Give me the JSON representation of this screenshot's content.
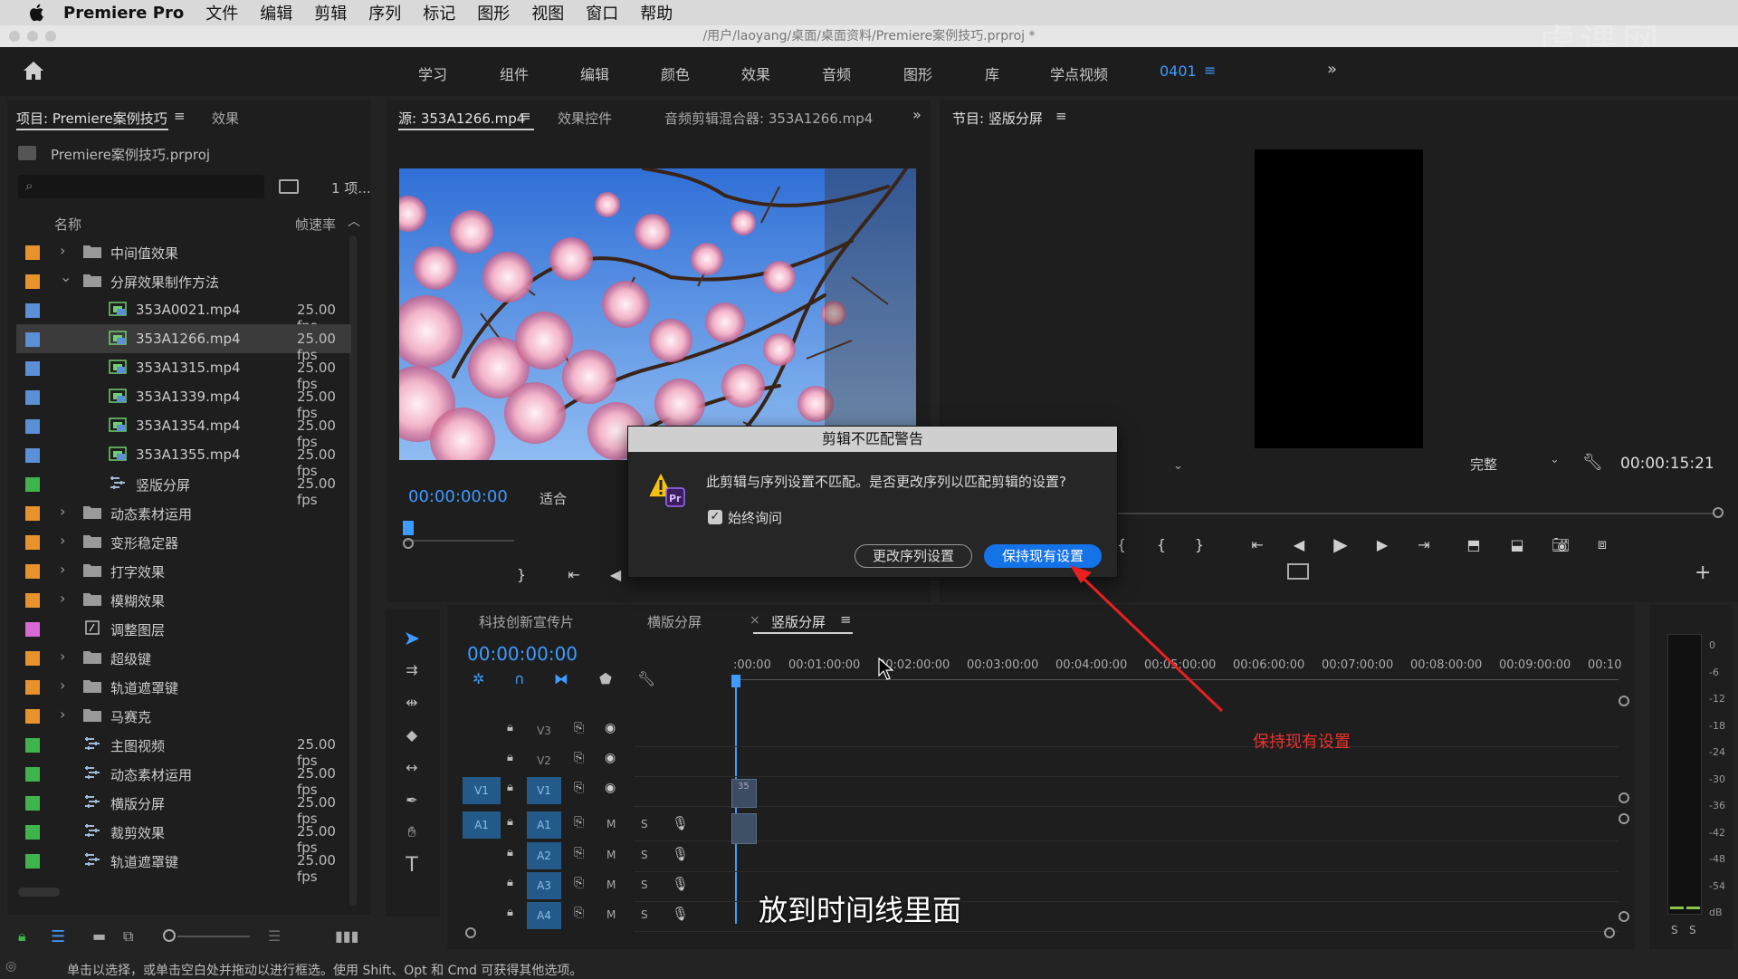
{
  "menubar": {
    "app": "Premiere Pro",
    "items": [
      "文件",
      "编辑",
      "剪辑",
      "序列",
      "标记",
      "图形",
      "视图",
      "窗口",
      "帮助"
    ]
  },
  "title": "/用户/laoyang/桌面/桌面资料/Premiere案例技巧.prproj *",
  "workspaces": [
    "学习",
    "组件",
    "编辑",
    "颜色",
    "效果",
    "音频",
    "图形",
    "库",
    "学点视频",
    "0401"
  ],
  "watermark": "虎课网",
  "project": {
    "tab": "项目: Premiere案例技巧",
    "tab2": "效果",
    "file": "Premiere案例技巧.prproj",
    "count": "1 项...",
    "col_name": "名称",
    "col_rate": "帧速率",
    "rows": [
      {
        "name": "中间值效果",
        "rate": "",
        "color": "#e8922e",
        "type": "folder",
        "indent": 0,
        "twirl": "closed"
      },
      {
        "name": "分屏效果制作方法",
        "rate": "",
        "color": "#e8922e",
        "type": "folder",
        "indent": 0,
        "twirl": "open"
      },
      {
        "name": "353A0021.mp4",
        "rate": "25.00 fps",
        "color": "#5b8fd6",
        "type": "clip",
        "indent": 1,
        "twirl": ""
      },
      {
        "name": "353A1266.mp4",
        "rate": "25.00 fps",
        "color": "#5b8fd6",
        "type": "clip",
        "indent": 1,
        "twirl": "",
        "selected": true
      },
      {
        "name": "353A1315.mp4",
        "rate": "25.00 fps",
        "color": "#5b8fd6",
        "type": "clip",
        "indent": 1,
        "twirl": ""
      },
      {
        "name": "353A1339.mp4",
        "rate": "25.00 fps",
        "color": "#5b8fd6",
        "type": "clip",
        "indent": 1,
        "twirl": ""
      },
      {
        "name": "353A1354.mp4",
        "rate": "25.00 fps",
        "color": "#5b8fd6",
        "type": "clip",
        "indent": 1,
        "twirl": ""
      },
      {
        "name": "353A1355.mp4",
        "rate": "25.00 fps",
        "color": "#5b8fd6",
        "type": "clip",
        "indent": 1,
        "twirl": ""
      },
      {
        "name": "竖版分屏",
        "rate": "25.00 fps",
        "color": "#3fb44c",
        "type": "seq",
        "indent": 1,
        "twirl": ""
      },
      {
        "name": "动态素材运用",
        "rate": "",
        "color": "#e8922e",
        "type": "folder",
        "indent": 0,
        "twirl": "closed"
      },
      {
        "name": "变形稳定器",
        "rate": "",
        "color": "#e8922e",
        "type": "folder",
        "indent": 0,
        "twirl": "closed"
      },
      {
        "name": "打字效果",
        "rate": "",
        "color": "#e8922e",
        "type": "folder",
        "indent": 0,
        "twirl": "closed"
      },
      {
        "name": "模糊效果",
        "rate": "",
        "color": "#e8922e",
        "type": "folder",
        "indent": 0,
        "twirl": "closed"
      },
      {
        "name": "调整图层",
        "rate": "",
        "color": "#d967d6",
        "type": "adj",
        "indent": 0,
        "twirl": ""
      },
      {
        "name": "超级键",
        "rate": "",
        "color": "#e8922e",
        "type": "folder",
        "indent": 0,
        "twirl": "closed"
      },
      {
        "name": "轨道遮罩键",
        "rate": "",
        "color": "#e8922e",
        "type": "folder",
        "indent": 0,
        "twirl": "closed"
      },
      {
        "name": "马赛克",
        "rate": "",
        "color": "#e8922e",
        "type": "folder",
        "indent": 0,
        "twirl": "closed"
      },
      {
        "name": "主图视频",
        "rate": "25.00 fps",
        "color": "#3fb44c",
        "type": "seq",
        "indent": 0,
        "twirl": ""
      },
      {
        "name": "动态素材运用",
        "rate": "25.00 fps",
        "color": "#3fb44c",
        "type": "seq",
        "indent": 0,
        "twirl": ""
      },
      {
        "name": "横版分屏",
        "rate": "25.00 fps",
        "color": "#3fb44c",
        "type": "seq",
        "indent": 0,
        "twirl": ""
      },
      {
        "name": "裁剪效果",
        "rate": "25.00 fps",
        "color": "#3fb44c",
        "type": "seq",
        "indent": 0,
        "twirl": ""
      },
      {
        "name": "轨道遮罩键",
        "rate": "25.00 fps",
        "color": "#3fb44c",
        "type": "seq",
        "indent": 0,
        "twirl": ""
      }
    ]
  },
  "source": {
    "tab": "源: 353A1266.mp4",
    "tab2": "效果控件",
    "tab3": "音频剪辑混合器: 353A1266.mp4",
    "timecode": "00:00:00:00",
    "fit": "适合"
  },
  "program": {
    "tab": "节目: 竖版分屏",
    "quality": "完整",
    "timecode": "00:00:15:21"
  },
  "dialog": {
    "title": "剪辑不匹配警告",
    "message": "此剪辑与序列设置不匹配。是否更改序列以匹配剪辑的设置?",
    "checkbox": "始终询问",
    "btn_change": "更改序列设置",
    "btn_keep": "保持现有设置"
  },
  "annotation": "保持现有设置",
  "timeline": {
    "tabs": [
      "科技创新宣传片",
      "横版分屏",
      "竖版分屏"
    ],
    "timecode": "00:00:00:00",
    "ruler": [
      ":00:00",
      "00:01:00:00",
      "00:02:00:00",
      "00:03:00:00",
      "00:04:00:00",
      "00:05:00:00",
      "00:06:00:00",
      "00:07:00:00",
      "00:08:00:00",
      "00:09:00:00",
      "00:10"
    ],
    "video_tracks": [
      "V3",
      "V2",
      "V1"
    ],
    "audio_tracks": [
      "A1",
      "A2",
      "A3",
      "A4"
    ],
    "src_v": "V1",
    "src_a": "A1",
    "m": "M",
    "s": "S",
    "clip_label": "35"
  },
  "meter": {
    "ticks": [
      "0",
      "-6",
      "-12",
      "-18",
      "-24",
      "-30",
      "-36",
      "-42",
      "-48",
      "-54",
      "dB"
    ],
    "solo": [
      "S",
      "S"
    ]
  },
  "subtitle": "放到时间线里面",
  "status": "单击以选择，或单击空白处并拖动以进行框选。使用 Shift、Opt 和 Cmd 可获得其他选项。"
}
